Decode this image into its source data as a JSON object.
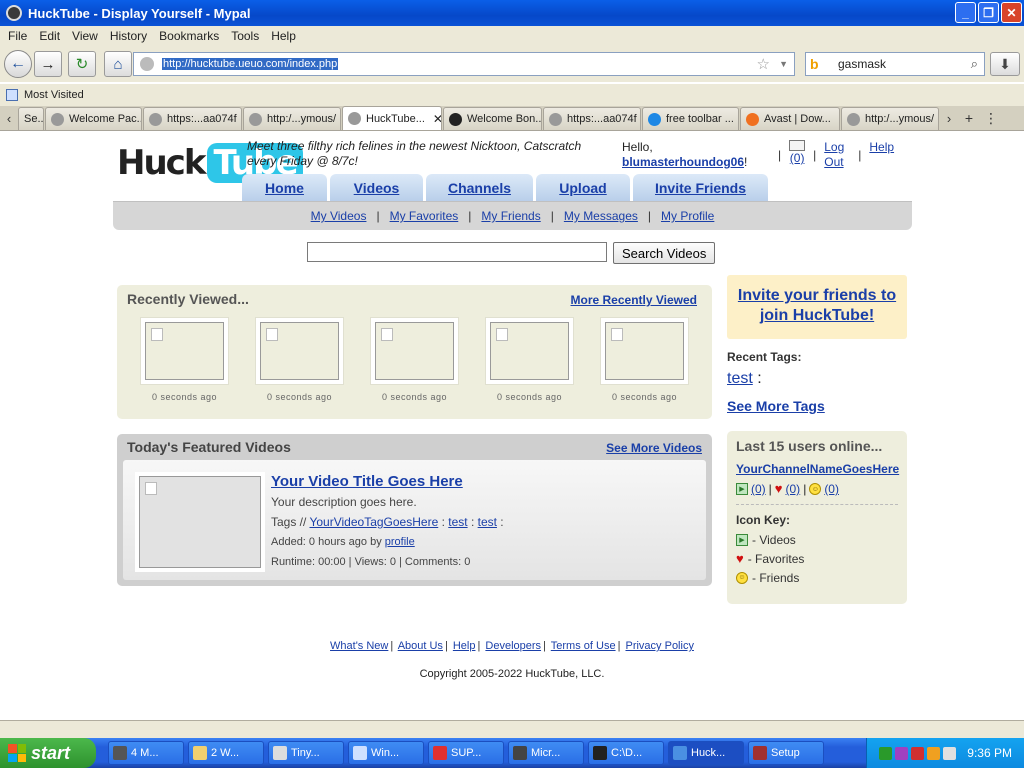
{
  "window": {
    "title": "HuckTube - Display Yourself - Mypal"
  },
  "menu": [
    "File",
    "Edit",
    "View",
    "History",
    "Bookmarks",
    "Tools",
    "Help"
  ],
  "nav": {
    "url": "http://hucktube.ueuo.com/index.php",
    "search_value": "gasmask"
  },
  "bookmarks": {
    "most_visited": "Most Visited"
  },
  "tabs": [
    {
      "label": "Se..."
    },
    {
      "label": "Welcome Pac..."
    },
    {
      "label": "https:...aa074f"
    },
    {
      "label": "http:/...ymous/"
    },
    {
      "label": "HuckTube...",
      "active": true
    },
    {
      "label": "Welcome Bon..."
    },
    {
      "label": "https:...aa074f"
    },
    {
      "label": "free toolbar ..."
    },
    {
      "label": "Avast | Dow..."
    },
    {
      "label": "http:/...ymous/"
    }
  ],
  "site": {
    "logo_left": "Huck",
    "logo_right": "Tube",
    "tagline": "Meet three filthy rich felines in the newest Nicktoon, Catscratch every Friday @ 8/7c!",
    "hello": "Hello,",
    "username": "blumasterhoundog06",
    "username_suffix": "!",
    "mail_count": "(0)",
    "logout": "Log Out",
    "help": "Help"
  },
  "main_tabs": [
    "Home",
    "Videos",
    "Channels",
    "Upload",
    "Invite Friends"
  ],
  "sub_nav": [
    "My Videos",
    "My Favorites",
    "My Friends",
    "My Messages",
    "My Profile"
  ],
  "search": {
    "button": "Search Videos"
  },
  "recent": {
    "heading": "Recently Viewed...",
    "more": "More Recently Viewed",
    "items": [
      "0 seconds ago",
      "0 seconds ago",
      "0 seconds ago",
      "0 seconds ago",
      "0 seconds ago"
    ]
  },
  "featured": {
    "heading": "Today's Featured Videos",
    "more": "See More Videos",
    "title": "Your Video Title Goes Here",
    "description": "Your description goes here.",
    "tags_label": "Tags //",
    "tag1": "YourVideoTagGoesHere",
    "tag2": "test",
    "tag3": "test",
    "added": "Added: 0 hours ago by",
    "added_by": "profile",
    "stats": "Runtime: 00:00 | Views: 0 | Comments: 0"
  },
  "invite": {
    "text": "Invite your friends to join HuckTube!"
  },
  "recent_tags": {
    "label": "Recent Tags:",
    "tag": "test",
    "see_more": "See More Tags"
  },
  "online": {
    "heading": "Last 15 users online...",
    "channel": "YourChannelNameGoesHere",
    "videos": "(0)",
    "favorites": "(0)",
    "friends": "(0)",
    "key_heading": "Icon Key:",
    "key_videos": "- Videos",
    "key_favorites": "- Favorites",
    "key_friends": "- Friends"
  },
  "footer": {
    "links": [
      "What's New",
      "About Us",
      "Help",
      "Developers",
      "Terms of Use",
      "Privacy Policy"
    ],
    "copyright": "Copyright 2005-2022 HuckTube, LLC."
  },
  "taskbar": {
    "start": "start",
    "tasks": [
      "4 M...",
      "2 W...",
      "Tiny...",
      "Win...",
      "SUP...",
      "Micr...",
      "C:\\D...",
      "Huck...",
      "Setup"
    ],
    "clock": "9:36 PM"
  }
}
